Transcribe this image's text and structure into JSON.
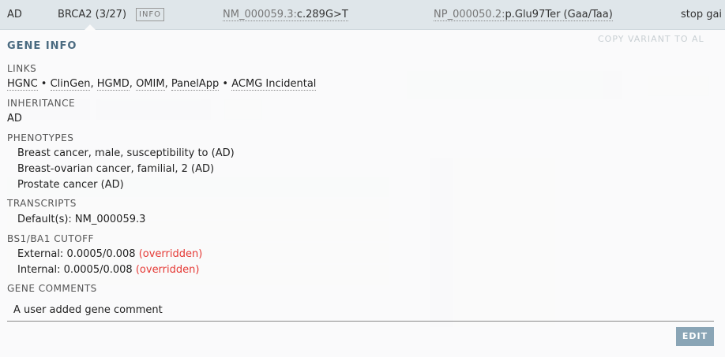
{
  "header": {
    "inheritance": "AD",
    "gene": "BRCA2 (3/27)",
    "info_tag": "INFO",
    "transcript_id": "NM_000059.3:",
    "transcript_change": "c.289G>T",
    "protein_id": "NP_000050.2:",
    "protein_change": "p.Glu97Ter (Gaa/Taa)",
    "consequence": "stop gai"
  },
  "popover": {
    "title": "GENE INFO",
    "links_label": "LINKS",
    "links": [
      "HGNC",
      "ClinGen",
      "HGMD",
      "OMIM",
      "PanelApp",
      "ACMG Incidental"
    ],
    "links_separators": [
      " • ",
      ", ",
      ", ",
      ", ",
      " • "
    ],
    "inheritance_label": "INHERITANCE",
    "inheritance_value": "AD",
    "phenotypes_label": "PHENOTYPES",
    "phenotypes": [
      "Breast cancer, male, susceptibility to (AD)",
      "Breast-ovarian cancer, familial, 2 (AD)",
      "Prostate cancer (AD)"
    ],
    "transcripts_label": "TRANSCRIPTS",
    "transcripts_value": "Default(s): NM_000059.3",
    "cutoff_label": "BS1/BA1 CUTOFF",
    "external_label": "External: 0.0005/0.008",
    "internal_label": "Internal: 0.0005/0.008",
    "overridden": "(overridden)",
    "gene_comments_label": "GENE COMMENTS",
    "gene_comment": "A user added gene comment",
    "edit_button": "EDIT",
    "copy_hint": "COPY VARIANT TO AL"
  },
  "colors": {
    "accent": "#4a6a80",
    "overridden": "#e53935",
    "edit_button": "#8aa5b6"
  }
}
